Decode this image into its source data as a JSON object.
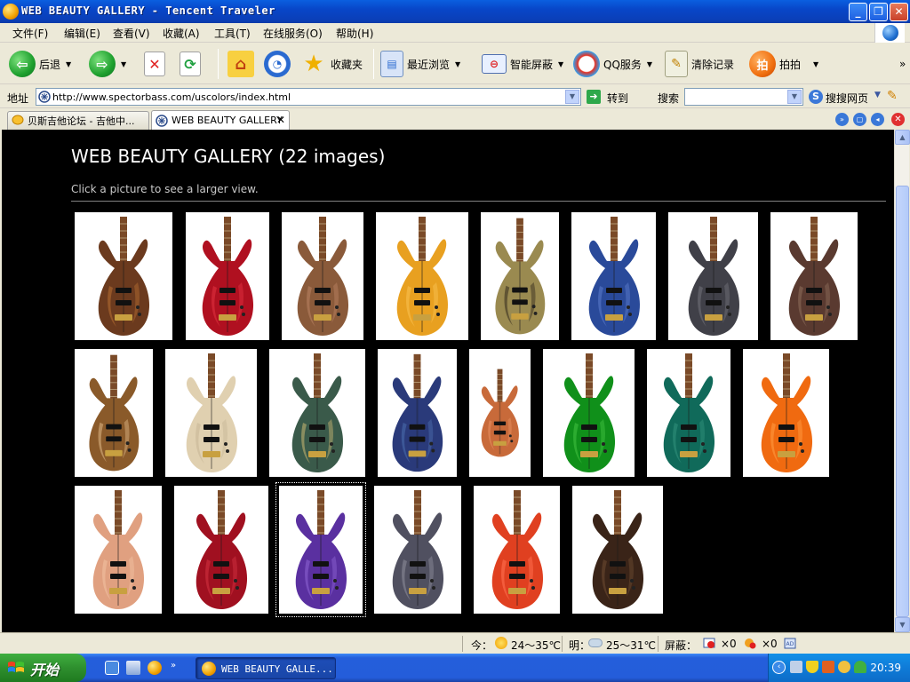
{
  "window": {
    "title": "WEB BEAUTY GALLERY - Tencent Traveler",
    "minimize": "_",
    "maximize": "❐",
    "close": "✕"
  },
  "menu": [
    "文件(F)",
    "编辑(E)",
    "查看(V)",
    "收藏(A)",
    "工具(T)",
    "在线服务(O)",
    "帮助(H)"
  ],
  "toolbar": {
    "back": "后退",
    "favorites": "收藏夹",
    "recent": "最近浏览",
    "smart_screen": "智能屏蔽",
    "qq_service": "QQ服务",
    "clear_history": "清除记录",
    "snap": "拍拍",
    "snap_icon_char": "拍",
    "more": "»"
  },
  "address": {
    "label": "地址",
    "url": "http://www.spectorbass.com/uscolors/index.html",
    "go_label": "转到",
    "search_label": "搜索",
    "search_value": "",
    "search_engine": "搜搜网页"
  },
  "tabs": [
    {
      "label": "贝斯吉他论坛 - 吉他中...",
      "active": false
    },
    {
      "label": "WEB BEAUTY GALLERY",
      "active": true
    }
  ],
  "page": {
    "title": "WEB BEAUTY GALLERY (22 images)",
    "subtitle": "Click a picture to see a larger view.",
    "images": [
      {
        "name": "bass-1",
        "body": "#6B3A1E",
        "accent": "#B06A30"
      },
      {
        "name": "bass-2",
        "body": "#B01020",
        "accent": "#E03040"
      },
      {
        "name": "bass-3",
        "body": "#8A5A3A",
        "accent": "#B88060"
      },
      {
        "name": "bass-4",
        "body": "#E8A020",
        "accent": "#F8C050"
      },
      {
        "name": "bass-5",
        "body": "#9A8A50",
        "accent": "#3A3020"
      },
      {
        "name": "bass-6",
        "body": "#2A4A9A",
        "accent": "#5A7ACA"
      },
      {
        "name": "bass-7",
        "body": "#404048",
        "accent": "#707078"
      },
      {
        "name": "bass-8",
        "body": "#5A3A30",
        "accent": "#8A6A58"
      },
      {
        "name": "bass-9",
        "body": "#8A5A2A",
        "accent": "#D8B080"
      },
      {
        "name": "bass-10",
        "body": "#E0D0B0",
        "accent": "#C8B898"
      },
      {
        "name": "bass-11",
        "body": "#3A5A4A",
        "accent": "#C0B070"
      },
      {
        "name": "bass-12",
        "body": "#2A3A7A",
        "accent": "#4A6AAA"
      },
      {
        "name": "bass-13",
        "body": "#C86A3A",
        "accent": "#E89060"
      },
      {
        "name": "bass-14",
        "body": "#10901A",
        "accent": "#40C040"
      },
      {
        "name": "bass-15",
        "body": "#106A5A",
        "accent": "#30907A"
      },
      {
        "name": "bass-16",
        "body": "#F06A10",
        "accent": "#FF9A40"
      },
      {
        "name": "bass-17",
        "body": "#E0A080",
        "accent": "#F0C0A0"
      },
      {
        "name": "bass-18",
        "body": "#A01020",
        "accent": "#D03040"
      },
      {
        "name": "bass-19",
        "body": "#5A30A0",
        "accent": "#8A60D0"
      },
      {
        "name": "bass-20",
        "body": "#505060",
        "accent": "#8A8A98"
      },
      {
        "name": "bass-21",
        "body": "#E04020",
        "accent": "#FF7050"
      },
      {
        "name": "bass-22",
        "body": "#3A2418",
        "accent": "#6A4A30"
      }
    ]
  },
  "status": {
    "today_label": "今：",
    "today_temp": "24～35℃",
    "tomorrow_label": "明：",
    "tomorrow_temp": "25～31℃",
    "blocked_label": "屏蔽：",
    "blocked_popups": "×0",
    "blocked_ads": "×0"
  },
  "taskbar": {
    "start": "开始",
    "window_button": "WEB BEAUTY GALLE...",
    "clock": "20:39"
  },
  "colors": {
    "title_bar": "#0A4FD0",
    "content_bg": "#000000",
    "taskbar": "#245EDB",
    "start_button": "#2E8F2E"
  }
}
